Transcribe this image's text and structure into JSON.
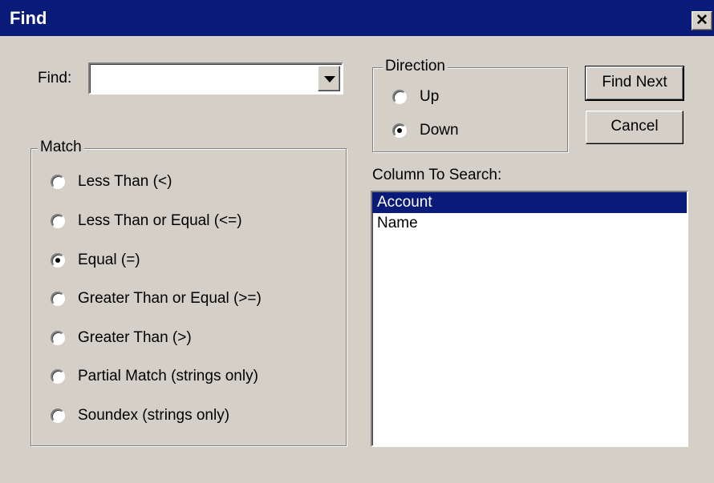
{
  "window": {
    "title": "Find",
    "close_symbol": "✕"
  },
  "find": {
    "label": "Find:",
    "value": ""
  },
  "match": {
    "legend": "Match",
    "selected_index": 2,
    "options": [
      "Less Than (<)",
      "Less Than or Equal (<=)",
      "Equal (=)",
      "Greater Than or Equal (>=)",
      "Greater Than (>)",
      "Partial Match (strings only)",
      "Soundex (strings only)"
    ]
  },
  "direction": {
    "legend": "Direction",
    "selected_index": 1,
    "options": [
      "Up",
      "Down"
    ]
  },
  "buttons": {
    "find_next": "Find Next",
    "cancel": "Cancel"
  },
  "column_to_search": {
    "label": "Column To Search:",
    "selected_index": 0,
    "items": [
      "Account",
      "Name"
    ]
  },
  "colors": {
    "title_bar": "#0a1a78",
    "face": "#d4d0c8",
    "selection": "#0a1a78"
  },
  "icons": {
    "close": "close-icon",
    "dropdown": "chevron-down-icon"
  }
}
